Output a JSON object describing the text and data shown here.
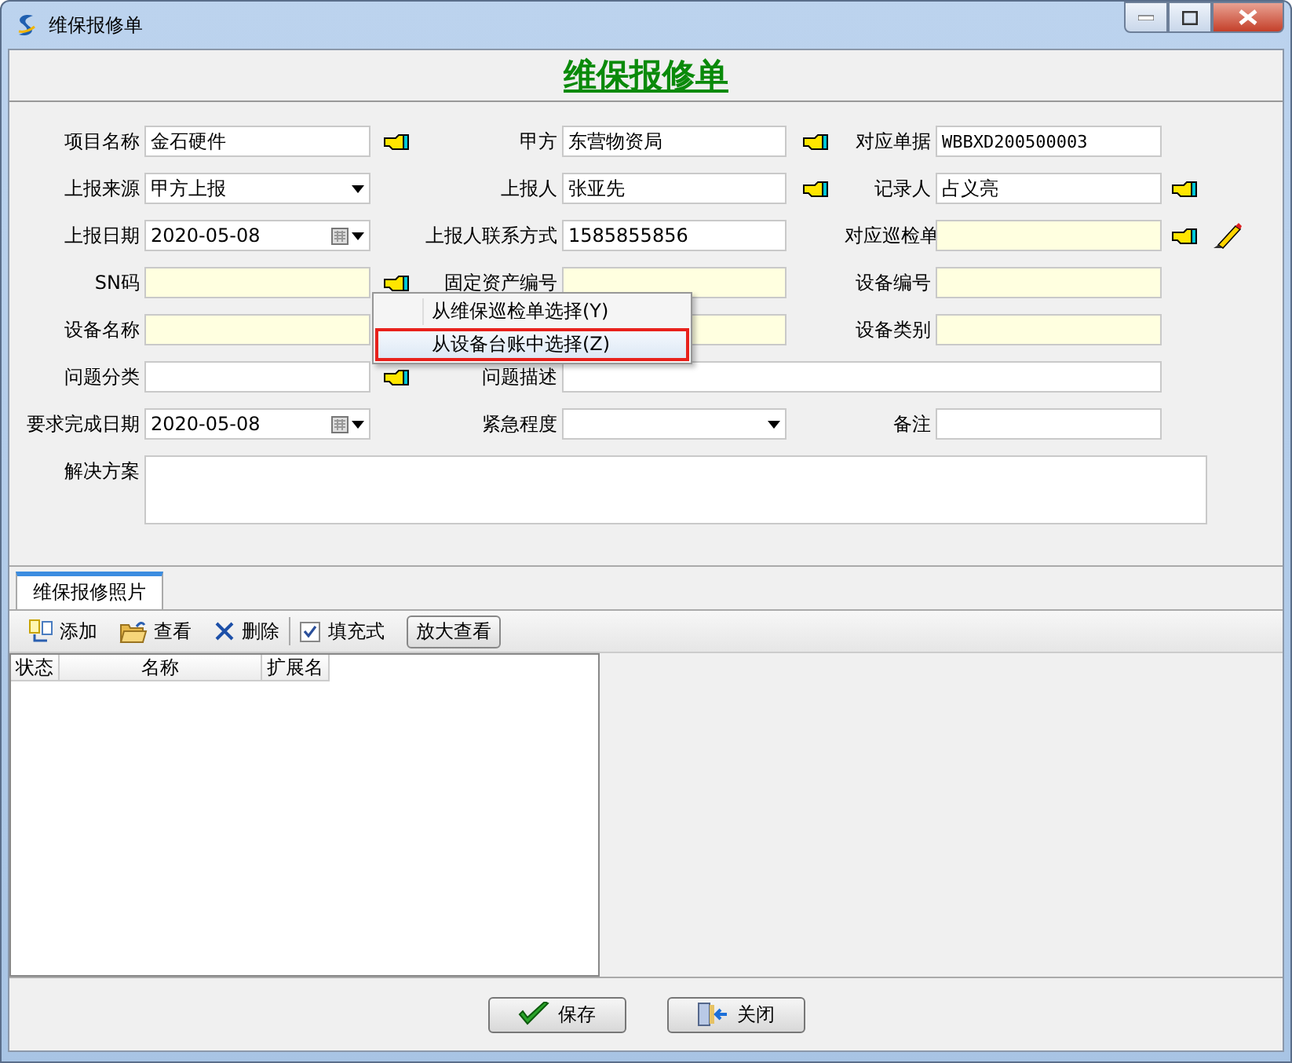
{
  "window": {
    "title": "维保报修单"
  },
  "header": {
    "title": "维保报修单"
  },
  "form": {
    "rows": [
      {
        "fields": [
          {
            "label": "项目名称",
            "value": "金石硬件",
            "kind": "text",
            "highlighted": false,
            "picker": true
          },
          {
            "label": "甲方",
            "value": "东营物资局",
            "kind": "text",
            "highlighted": false,
            "picker": true
          },
          {
            "label": "对应单据",
            "value": "WBBXD200500003",
            "kind": "code",
            "highlighted": false,
            "picker": false
          }
        ]
      },
      {
        "fields": [
          {
            "label": "上报来源",
            "value": "甲方上报",
            "kind": "combo",
            "highlighted": false,
            "picker": false
          },
          {
            "label": "上报人",
            "value": "张亚先",
            "kind": "text",
            "highlighted": false,
            "picker": true
          },
          {
            "label": "记录人",
            "value": "占义亮",
            "kind": "text",
            "highlighted": false,
            "picker": true
          }
        ]
      },
      {
        "fields": [
          {
            "label": "上报日期",
            "value": "2020-05-08",
            "kind": "date",
            "highlighted": false,
            "picker": false
          },
          {
            "label": "上报人联系方式",
            "value": "1585855856",
            "kind": "text",
            "highlighted": false,
            "picker": false
          },
          {
            "label": "对应巡检单",
            "kind": "text",
            "highlighted": true,
            "picker": true,
            "pen": true
          }
        ]
      },
      {
        "fields": [
          {
            "label": "SN码",
            "kind": "text",
            "highlighted": true,
            "picker": true
          },
          {
            "label": "固定资产编号",
            "kind": "text",
            "highlighted": true,
            "picker": false
          },
          {
            "label": "设备编号",
            "kind": "text",
            "highlighted": true,
            "picker": false
          }
        ]
      },
      {
        "fields": [
          {
            "label": "设备名称",
            "kind": "text",
            "highlighted": true,
            "picker": false
          },
          {
            "kind": "text",
            "highlighted": true,
            "picker": false
          },
          {
            "label": "设备类别",
            "kind": "text",
            "highlighted": true,
            "picker": false
          }
        ]
      },
      {
        "fields": [
          {
            "label": "问题分类",
            "kind": "text",
            "highlighted": false,
            "picker": true
          },
          {
            "label": "问题描述",
            "kind": "text",
            "highlighted": false,
            "picker": false
          }
        ]
      },
      {
        "fields": [
          {
            "label": "要求完成日期",
            "value": "2020-05-08",
            "kind": "date",
            "highlighted": false,
            "picker": false
          },
          {
            "label": "紧急程度",
            "kind": "combo",
            "highlighted": false,
            "picker": false
          },
          {
            "label": "备注",
            "kind": "text",
            "highlighted": false,
            "picker": false
          }
        ]
      },
      {
        "fields": [
          {
            "label": "解决方案",
            "kind": "memo",
            "highlighted": false,
            "picker": false
          }
        ]
      }
    ]
  },
  "context_menu": {
    "items": [
      {
        "label": "从维保巡检单选择(Y)",
        "selected": false,
        "annotated": false
      },
      {
        "label": "从设备台账中选择(Z)",
        "selected": true,
        "annotated": true
      }
    ]
  },
  "photos": {
    "tabs": [
      {
        "label": "维保报修照片",
        "selected": true
      }
    ],
    "toolbar": [
      {
        "kind": "add",
        "label": "添加"
      },
      {
        "kind": "view",
        "label": "查看"
      },
      {
        "kind": "delete",
        "label": "删除"
      },
      {
        "kind": "separator"
      },
      {
        "kind": "checkbox",
        "label": "填充式",
        "checked": true
      },
      {
        "kind": "button",
        "label": "放大查看"
      }
    ],
    "columns": [
      "状态",
      "名称",
      "扩展名"
    ]
  },
  "buttons": [
    {
      "kind": "save",
      "label": "保存"
    },
    {
      "kind": "close",
      "label": "关闭"
    }
  ]
}
